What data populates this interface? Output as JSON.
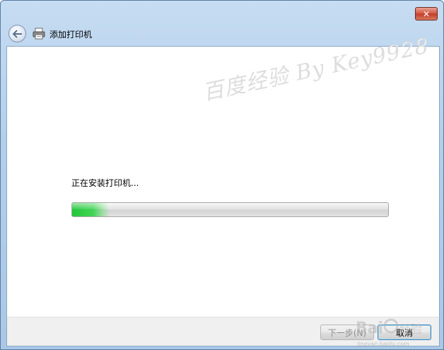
{
  "window": {
    "close_glyph": "✕"
  },
  "nav": {
    "title": "添加打印机",
    "back_icon": "back-arrow-icon",
    "app_icon": "printer-icon"
  },
  "main": {
    "status_text": "正在安装打印机...",
    "progress_fraction": 0.12,
    "progress_color": "#2fcc43"
  },
  "footer": {
    "next_label": "下一步(N)",
    "cancel_label": "取消"
  },
  "watermark": {
    "text": "百度经验 By Key9928",
    "logo_text": "Baidu 经验",
    "logo_url_text": "jingyan.baidu.com"
  }
}
